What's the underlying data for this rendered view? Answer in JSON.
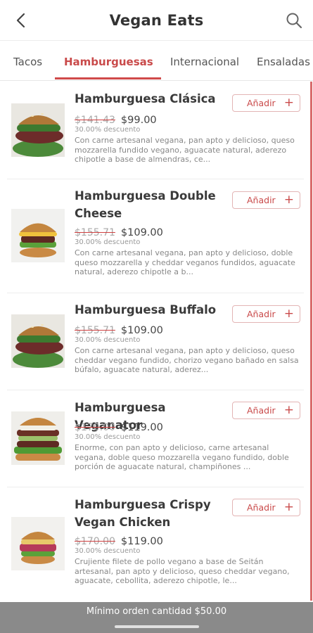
{
  "header": {
    "title": "Vegan Eats",
    "back_icon": "back-chevron-icon",
    "search_icon": "search-icon"
  },
  "tabs": [
    {
      "label": "Tacos",
      "active": false
    },
    {
      "label": "Hamburguesas",
      "active": true
    },
    {
      "label": "Internacional",
      "active": false
    },
    {
      "label": "Ensaladas",
      "active": false
    }
  ],
  "add_label": "Añadir",
  "add_icon": "plus-icon",
  "accent_color": "#c94a4a",
  "items": [
    {
      "name": "Hamburguesa Clásica",
      "old_price": "$141.43",
      "price": "$99.00",
      "discount": "30.00% descuento",
      "description": "Con carne artesanal vegana, pan apto y delicioso, queso mozzarella fundido vegano, aguacate natural, aderezo chipotle a base de almendras, ce..."
    },
    {
      "name": "Hamburguesa Double Cheese",
      "old_price": "$155.71",
      "price": "$109.00",
      "discount": "30.00% descuento",
      "description": "Con carne artesanal vegana, pan apto y delicioso, doble queso mozzarella y cheddar veganos fundidos, aguacate natural, aderezo chipotle a b..."
    },
    {
      "name": "Hamburguesa Buffalo",
      "old_price": "$155.71",
      "price": "$109.00",
      "discount": "30.00% descuento",
      "description": "Con carne artesanal vegana, pan apto y delicioso, queso cheddar vegano fundido, chorizo vegano bañado en salsa búfalo, aguacate natural, aderez..."
    },
    {
      "name": "Hamburguesa Veganator",
      "old_price": "$170.00",
      "price": "$119.00",
      "discount": "30.00% descuento",
      "description": "Enorme, con pan apto y delicioso, carne artesanal vegana, doble queso mozzarella vegano fundido, doble porción de aguacate natural, champiñones ..."
    },
    {
      "name": "Hamburguesa Crispy Vegan Chicken",
      "old_price": "$170.00",
      "price": "$119.00",
      "discount": "30.00% descuento",
      "description": "Crujiente filete de pollo vegano a base de Seitán artesanal, pan apto y delicioso, queso cheddar vegano, aguacate, cebollita, aderezo chipotle, le..."
    }
  ],
  "footer": {
    "min_order": "Mínimo orden cantidad $50.00"
  }
}
